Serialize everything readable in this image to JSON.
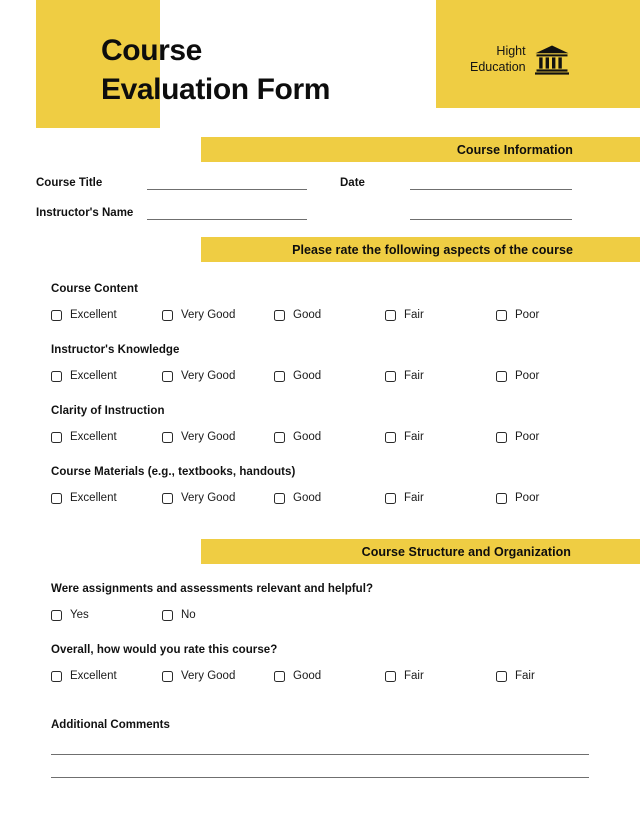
{
  "theme": {
    "accent": "#EFCD43",
    "text": "#111111",
    "rule": "#6F6F6F"
  },
  "header": {
    "title_line1": "Course",
    "title_line2": "Evaluation Form",
    "brand_line1": "Hight",
    "brand_line2": "Education",
    "brand_icon": "bank-building-icon"
  },
  "sections": {
    "course_information": "Course Information",
    "please_rate": "Please rate the following aspects of the course",
    "course_structure": "Course Structure and Organization"
  },
  "course_info": {
    "course_title_label": "Course Title",
    "date_label": "Date",
    "instructor_label": "Instructor's Name",
    "course_title_value": "",
    "date_value": "",
    "instructor_value": "",
    "date_second_value": ""
  },
  "rating_groups": [
    {
      "label": "Course Content",
      "options": [
        "Excellent",
        "Very Good",
        "Good",
        "Fair",
        "Poor"
      ]
    },
    {
      "label": "Instructor's Knowledge",
      "options": [
        "Excellent",
        "Very Good",
        "Good",
        "Fair",
        "Poor"
      ]
    },
    {
      "label": "Clarity of Instruction",
      "options": [
        "Excellent",
        "Very Good",
        "Good",
        "Fair",
        "Poor"
      ]
    },
    {
      "label": "Course Materials (e.g., textbooks, handouts)",
      "options": [
        "Excellent",
        "Very Good",
        "Good",
        "Fair",
        "Poor"
      ]
    }
  ],
  "structure_groups": [
    {
      "label": "Were assignments and assessments relevant and helpful?",
      "options": [
        "Yes",
        "No"
      ]
    },
    {
      "label": "Overall, how would you rate this course?",
      "options": [
        "Excellent",
        "Very Good",
        "Good",
        "Fair",
        "Fair"
      ]
    }
  ],
  "comments": {
    "label": "Additional Comments",
    "line_count": 2,
    "value": ""
  }
}
